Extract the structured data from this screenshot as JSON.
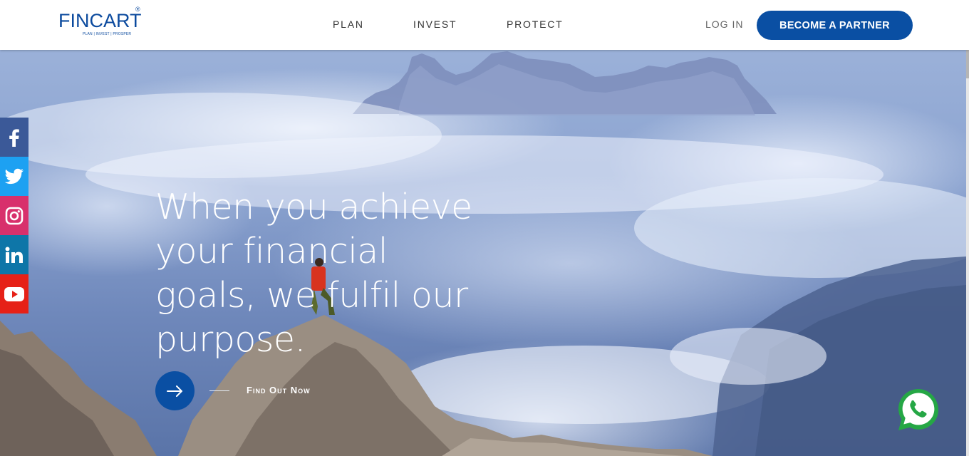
{
  "brand": {
    "name": "FINCART",
    "tagline": "PLAN | INVEST | PROSPER",
    "registered": "®"
  },
  "nav": {
    "items": [
      {
        "label": "PLAN"
      },
      {
        "label": "INVEST"
      },
      {
        "label": "PROTECT"
      }
    ],
    "login_label": "LOG IN",
    "partner_label": "BECOME A PARTNER"
  },
  "hero": {
    "headline_lines": [
      "When you achieve",
      "your financial",
      "goals, we fulfil our",
      "purpose."
    ],
    "cta_label": "Find Out Now"
  },
  "social": [
    {
      "name": "facebook-icon",
      "color": "#3b5998"
    },
    {
      "name": "twitter-icon",
      "color": "#1da1f2"
    },
    {
      "name": "instagram-icon",
      "color": "#d8306c"
    },
    {
      "name": "linkedin-icon",
      "color": "#0e76a8"
    },
    {
      "name": "youtube-icon",
      "color": "#e62117"
    }
  ],
  "colors": {
    "brand_blue": "#0a4fa3",
    "whatsapp_green": "#25a745"
  }
}
